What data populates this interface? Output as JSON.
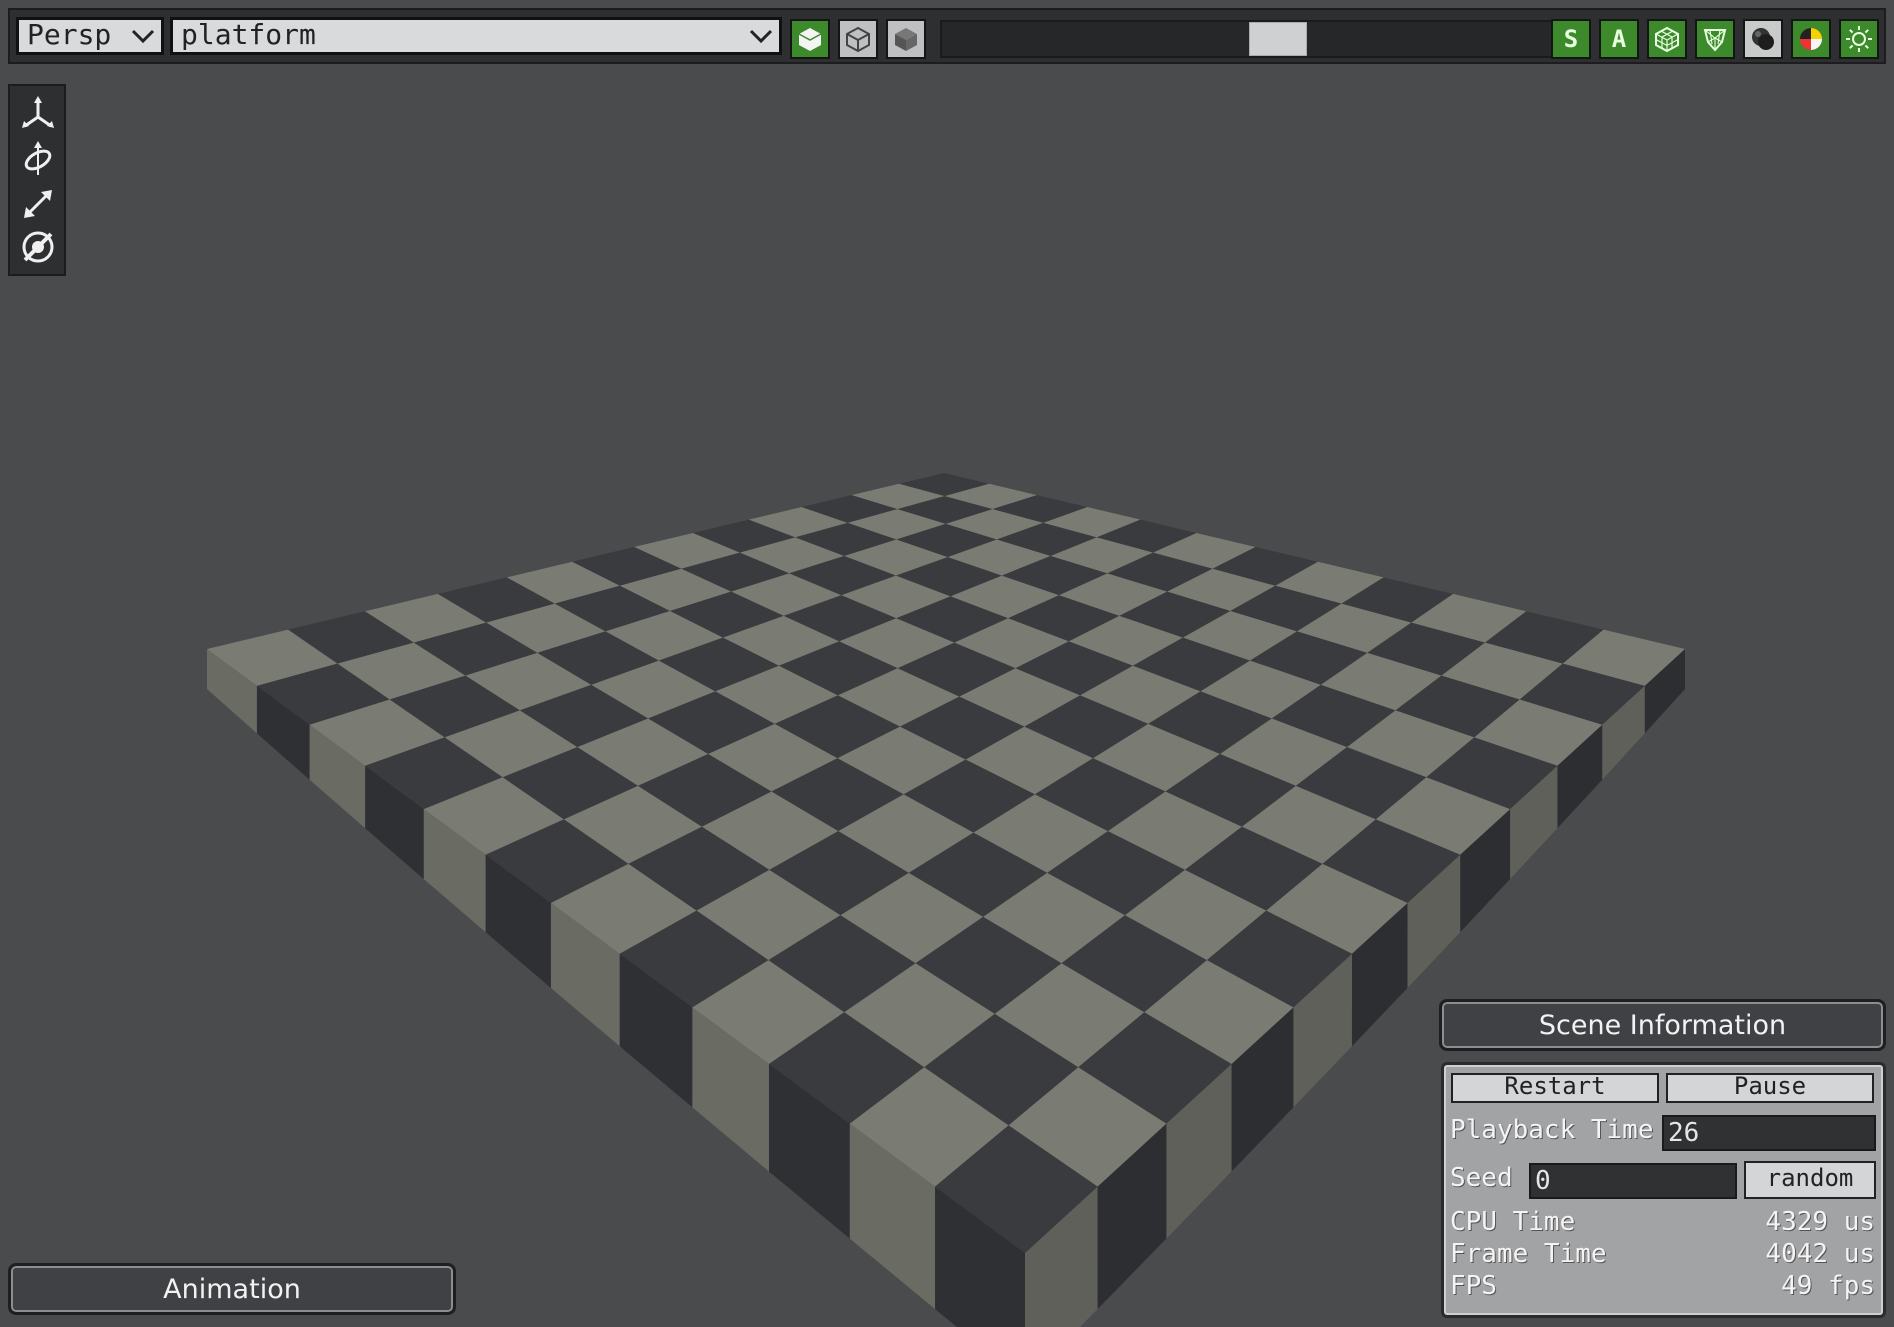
{
  "toolbar": {
    "view_mode": "Persp",
    "scene_select": "platform",
    "buttons": [
      {
        "label": "",
        "icon": "solid-cube-icon"
      },
      {
        "label": "",
        "icon": "wireframe-cube-icon"
      },
      {
        "label": "",
        "icon": "shaded-cube-icon"
      },
      {
        "label": "S",
        "icon": ""
      },
      {
        "label": "A",
        "icon": ""
      },
      {
        "label": "",
        "icon": "grid-cube-icon"
      },
      {
        "label": "",
        "icon": "shield-mesh-icon"
      },
      {
        "label": "",
        "icon": "shadow-sphere-icon"
      },
      {
        "label": "",
        "icon": "color-sphere-icon"
      },
      {
        "label": "",
        "icon": "sun-icon"
      }
    ],
    "accent": "#3d8a2c"
  },
  "tools": [
    "translate-icon",
    "rotate-icon",
    "scale-icon",
    "visibility-icon"
  ],
  "viewport": {
    "background": "#4a4b4d",
    "board": {
      "rows": 12,
      "cols": 12,
      "dark": "#3a3b3e",
      "light": "#7a7b72"
    }
  },
  "animation_panel": {
    "title": "Animation"
  },
  "scene_panel": {
    "title": "Scene Information",
    "restart_label": "Restart",
    "pause_label": "Pause",
    "playback_label": "Playback Time",
    "playback_value": "26",
    "seed_label": "Seed",
    "seed_value": "0",
    "random_label": "random",
    "stats": [
      {
        "label": "CPU Time",
        "value": "4329 us"
      },
      {
        "label": "Frame Time",
        "value": "4042 us"
      },
      {
        "label": "FPS",
        "value": "49 fps"
      }
    ]
  }
}
